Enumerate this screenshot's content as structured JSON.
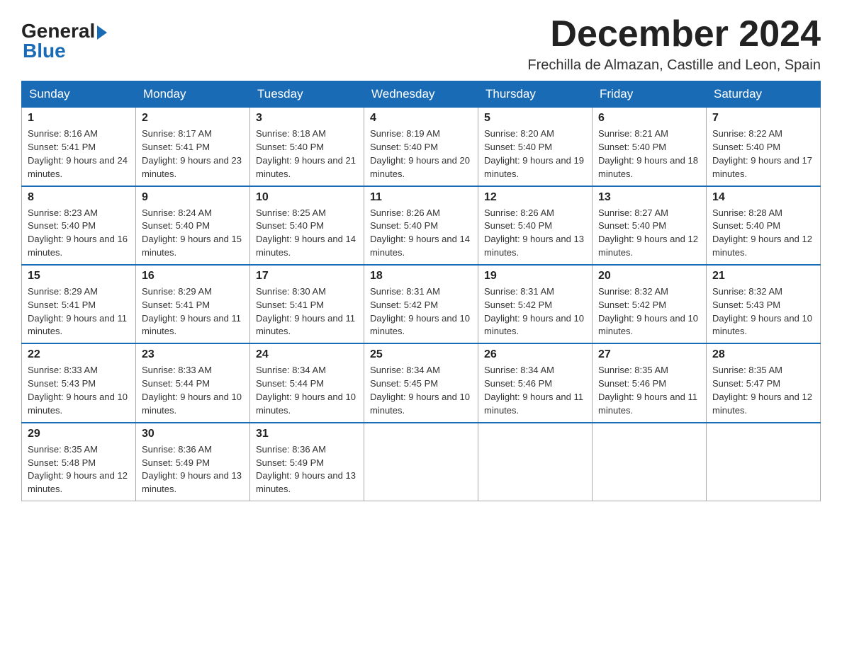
{
  "logo": {
    "general": "General",
    "blue": "Blue"
  },
  "header": {
    "month_year": "December 2024",
    "location": "Frechilla de Almazan, Castille and Leon, Spain"
  },
  "weekdays": [
    "Sunday",
    "Monday",
    "Tuesday",
    "Wednesday",
    "Thursday",
    "Friday",
    "Saturday"
  ],
  "weeks": [
    [
      {
        "day": "1",
        "sunrise": "8:16 AM",
        "sunset": "5:41 PM",
        "daylight": "9 hours and 24 minutes."
      },
      {
        "day": "2",
        "sunrise": "8:17 AM",
        "sunset": "5:41 PM",
        "daylight": "9 hours and 23 minutes."
      },
      {
        "day": "3",
        "sunrise": "8:18 AM",
        "sunset": "5:40 PM",
        "daylight": "9 hours and 21 minutes."
      },
      {
        "day": "4",
        "sunrise": "8:19 AM",
        "sunset": "5:40 PM",
        "daylight": "9 hours and 20 minutes."
      },
      {
        "day": "5",
        "sunrise": "8:20 AM",
        "sunset": "5:40 PM",
        "daylight": "9 hours and 19 minutes."
      },
      {
        "day": "6",
        "sunrise": "8:21 AM",
        "sunset": "5:40 PM",
        "daylight": "9 hours and 18 minutes."
      },
      {
        "day": "7",
        "sunrise": "8:22 AM",
        "sunset": "5:40 PM",
        "daylight": "9 hours and 17 minutes."
      }
    ],
    [
      {
        "day": "8",
        "sunrise": "8:23 AM",
        "sunset": "5:40 PM",
        "daylight": "9 hours and 16 minutes."
      },
      {
        "day": "9",
        "sunrise": "8:24 AM",
        "sunset": "5:40 PM",
        "daylight": "9 hours and 15 minutes."
      },
      {
        "day": "10",
        "sunrise": "8:25 AM",
        "sunset": "5:40 PM",
        "daylight": "9 hours and 14 minutes."
      },
      {
        "day": "11",
        "sunrise": "8:26 AM",
        "sunset": "5:40 PM",
        "daylight": "9 hours and 14 minutes."
      },
      {
        "day": "12",
        "sunrise": "8:26 AM",
        "sunset": "5:40 PM",
        "daylight": "9 hours and 13 minutes."
      },
      {
        "day": "13",
        "sunrise": "8:27 AM",
        "sunset": "5:40 PM",
        "daylight": "9 hours and 12 minutes."
      },
      {
        "day": "14",
        "sunrise": "8:28 AM",
        "sunset": "5:40 PM",
        "daylight": "9 hours and 12 minutes."
      }
    ],
    [
      {
        "day": "15",
        "sunrise": "8:29 AM",
        "sunset": "5:41 PM",
        "daylight": "9 hours and 11 minutes."
      },
      {
        "day": "16",
        "sunrise": "8:29 AM",
        "sunset": "5:41 PM",
        "daylight": "9 hours and 11 minutes."
      },
      {
        "day": "17",
        "sunrise": "8:30 AM",
        "sunset": "5:41 PM",
        "daylight": "9 hours and 11 minutes."
      },
      {
        "day": "18",
        "sunrise": "8:31 AM",
        "sunset": "5:42 PM",
        "daylight": "9 hours and 10 minutes."
      },
      {
        "day": "19",
        "sunrise": "8:31 AM",
        "sunset": "5:42 PM",
        "daylight": "9 hours and 10 minutes."
      },
      {
        "day": "20",
        "sunrise": "8:32 AM",
        "sunset": "5:42 PM",
        "daylight": "9 hours and 10 minutes."
      },
      {
        "day": "21",
        "sunrise": "8:32 AM",
        "sunset": "5:43 PM",
        "daylight": "9 hours and 10 minutes."
      }
    ],
    [
      {
        "day": "22",
        "sunrise": "8:33 AM",
        "sunset": "5:43 PM",
        "daylight": "9 hours and 10 minutes."
      },
      {
        "day": "23",
        "sunrise": "8:33 AM",
        "sunset": "5:44 PM",
        "daylight": "9 hours and 10 minutes."
      },
      {
        "day": "24",
        "sunrise": "8:34 AM",
        "sunset": "5:44 PM",
        "daylight": "9 hours and 10 minutes."
      },
      {
        "day": "25",
        "sunrise": "8:34 AM",
        "sunset": "5:45 PM",
        "daylight": "9 hours and 10 minutes."
      },
      {
        "day": "26",
        "sunrise": "8:34 AM",
        "sunset": "5:46 PM",
        "daylight": "9 hours and 11 minutes."
      },
      {
        "day": "27",
        "sunrise": "8:35 AM",
        "sunset": "5:46 PM",
        "daylight": "9 hours and 11 minutes."
      },
      {
        "day": "28",
        "sunrise": "8:35 AM",
        "sunset": "5:47 PM",
        "daylight": "9 hours and 12 minutes."
      }
    ],
    [
      {
        "day": "29",
        "sunrise": "8:35 AM",
        "sunset": "5:48 PM",
        "daylight": "9 hours and 12 minutes."
      },
      {
        "day": "30",
        "sunrise": "8:36 AM",
        "sunset": "5:49 PM",
        "daylight": "9 hours and 13 minutes."
      },
      {
        "day": "31",
        "sunrise": "8:36 AM",
        "sunset": "5:49 PM",
        "daylight": "9 hours and 13 minutes."
      },
      null,
      null,
      null,
      null
    ]
  ]
}
